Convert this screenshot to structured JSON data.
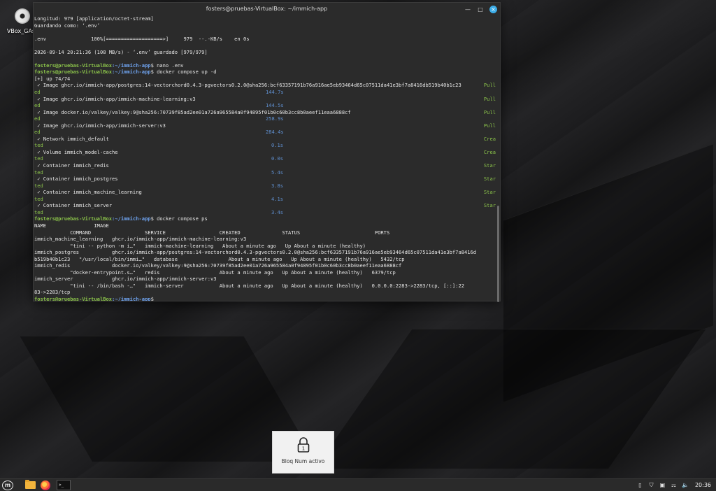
{
  "desktop": {
    "icon_label": "VBox_GAs_"
  },
  "window": {
    "title": "fosters@pruebas-VirtualBox: ~/immich-app"
  },
  "prompt": {
    "user": "fosters@pruebas-VirtualBox",
    "path": ":~/immich-app"
  },
  "terminal": {
    "l1": "Longitud: 979 [application/octet-stream]",
    "l2": "Guardando como: ‘.env’",
    "l3": ".env               100%[===================>]     979  --.-KB/s    en 0s",
    "l4": "2026-09-14 20:21:36 (108 MB/s) - ‘.env’ guardado [979/979]",
    "cmd_nano": "$ nano .env",
    "cmd_up": "$ docker compose up -d",
    "up_status": "[+] up 74/74",
    "pull1_text": " ✓ Image ghcr.io/immich-app/postgres:14-vectorchord0.4.3-pgvectors0.2.0@sha256:bcf63357191b76a916ae5eb93464d65c07511da41e3bf7a8416db519b40b1c23",
    "pull1_status": "Pull",
    "pull1_cont": "ed",
    "pull1_time": "144.7s",
    "pull2_text": " ✓ Image ghcr.io/immich-app/immich-machine-learning:v3",
    "pull2_status": "Pull",
    "pull2_cont": "ed",
    "pull2_time": "144.5s",
    "pull3_text": " ✓ Image docker.io/valkey/valkey:9@sha256:70739f85ad2ee01a726a965584a0f94895f01b0c60b3cc8b0aeef11eaa6888cf",
    "pull3_status": "Pull",
    "pull3_cont": "ed",
    "pull3_time": "258.9s",
    "pull4_text": " ✓ Image ghcr.io/immich-app/immich-server:v3",
    "pull4_status": "Pull",
    "pull4_cont": "ed",
    "pull4_time": "284.4s",
    "net_text": " ✓ Network immich_default",
    "net_status": "Crea",
    "net_cont": "ted",
    "net_time": "0.1s",
    "vol_text": " ✓ Volume immich_model-cache",
    "vol_status": "Crea",
    "vol_cont": "ted",
    "vol_time": "0.0s",
    "c1_text": " ✓ Container immich_redis",
    "c1_status": "Star",
    "c1_cont": "ted",
    "c1_time": "5.4s",
    "c2_text": " ✓ Container immich_postgres",
    "c2_status": "Star",
    "c2_cont": "ted",
    "c2_time": "3.8s",
    "c3_text": " ✓ Container immich_machine_learning",
    "c3_status": "Star",
    "c3_cont": "ted",
    "c3_time": "4.1s",
    "c4_text": " ✓ Container immich_server",
    "c4_status": "Star",
    "c4_cont": "ted",
    "c4_time": "3.4s",
    "cmd_ps": "$ docker compose ps",
    "ps_h1": "NAME                IMAGE",
    "ps_h2": "            COMMAND                  SERVICE                  CREATED              STATUS                         PORTS",
    "ps1a": "immich_machine_learning   ghcr.io/immich-app/immich-machine-learning:v3",
    "ps1b": "            \"tini -- python -m i…\"   immich-machine-learning   About a minute ago   Up About a minute (healthy)",
    "ps2a": "immich_postgres           ghcr.io/immich-app/postgres:14-vectorchord0.4.3-pgvectors0.2.0@sha256:bcf63357191b76a916ae5eb93464d65c07511da41e3bf7a8416d",
    "ps2b": "b519b40b1c23   \"/usr/local/bin/immi…\"   database                 About a minute ago   Up About a minute (healthy)   5432/tcp",
    "ps3a": "immich_redis              docker.io/valkey/valkey:9@sha256:70739f85ad2ee01a726a965584a0f94895f01b0c60b3cc8b0aeef11eaa6888cf",
    "ps3b": "            \"docker-entrypoint.s…\"   redis                    About a minute ago   Up About a minute (healthy)   6379/tcp",
    "ps4a": "immich_server             ghcr.io/immich-app/immich-server:v3",
    "ps4b": "            \"tini -- /bin/bash -…\"   immich-server            About a minute ago   Up About a minute (healthy)   0.0.0.0:2283->2283/tcp, [::]:22",
    "ps4c": "83->2283/tcp",
    "prompt_end": "$"
  },
  "osd": {
    "text": "Bloq Num activo",
    "icon": "lock-1-icon"
  },
  "panel": {
    "terminal_button": ">_",
    "clock": "20:36"
  },
  "colors": {
    "prompt_user": "#8bc34a",
    "prompt_path": "#6fa3ef",
    "status_green": "#8bc34a",
    "time_blue": "#5f8fcf",
    "close_button": "#3daee9"
  }
}
